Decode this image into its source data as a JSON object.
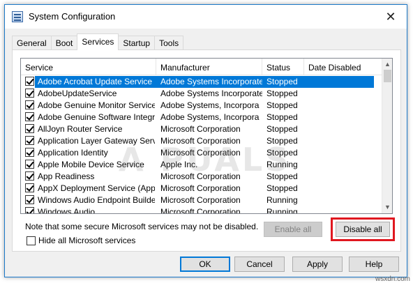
{
  "window": {
    "title": "System Configuration",
    "close_glyph": "✕"
  },
  "tabs": [
    "General",
    "Boot",
    "Services",
    "Startup",
    "Tools"
  ],
  "active_tab": "Services",
  "list": {
    "columns": [
      "Service",
      "Manufacturer",
      "Status",
      "Date Disabled"
    ],
    "rows": [
      {
        "service": "Adobe Acrobat Update Service",
        "manufacturer": "Adobe Systems Incorporated",
        "status": "Stopped",
        "date_disabled": "",
        "checked": true,
        "selected": true
      },
      {
        "service": "AdobeUpdateService",
        "manufacturer": "Adobe Systems Incorporated",
        "status": "Stopped",
        "date_disabled": "",
        "checked": true
      },
      {
        "service": "Adobe Genuine Monitor Service",
        "manufacturer": "Adobe Systems, Incorpora",
        "status": "Stopped",
        "date_disabled": "",
        "checked": true
      },
      {
        "service": "Adobe Genuine Software Integri...",
        "manufacturer": "Adobe Systems, Incorpora",
        "status": "Stopped",
        "date_disabled": "",
        "checked": true
      },
      {
        "service": "AllJoyn Router Service",
        "manufacturer": "Microsoft Corporation",
        "status": "Stopped",
        "date_disabled": "",
        "checked": true
      },
      {
        "service": "Application Layer Gateway Service",
        "manufacturer": "Microsoft Corporation",
        "status": "Stopped",
        "date_disabled": "",
        "checked": true
      },
      {
        "service": "Application Identity",
        "manufacturer": "Microsoft Corporation",
        "status": "Stopped",
        "date_disabled": "",
        "checked": true
      },
      {
        "service": "Apple Mobile Device Service",
        "manufacturer": "Apple Inc.",
        "status": "Running",
        "date_disabled": "",
        "checked": true
      },
      {
        "service": "App Readiness",
        "manufacturer": "Microsoft Corporation",
        "status": "Stopped",
        "date_disabled": "",
        "checked": true
      },
      {
        "service": "AppX Deployment Service (AppX...",
        "manufacturer": "Microsoft Corporation",
        "status": "Stopped",
        "date_disabled": "",
        "checked": true
      },
      {
        "service": "Windows Audio Endpoint Builder",
        "manufacturer": "Microsoft Corporation",
        "status": "Running",
        "date_disabled": "",
        "checked": true
      },
      {
        "service": "Windows Audio",
        "manufacturer": "Microsoft Corporation",
        "status": "Running",
        "date_disabled": "",
        "checked": true
      }
    ]
  },
  "scrollbar": {
    "up_glyph": "▲",
    "down_glyph": "▼"
  },
  "note": "Note that some secure Microsoft services may not be disabled.",
  "buttons": {
    "enable_all": "Enable all",
    "disable_all": "Disable all",
    "ok": "OK",
    "cancel": "Cancel",
    "apply": "Apply",
    "help": "Help"
  },
  "hide_ms_label": "Hide all Microsoft services",
  "hide_ms_checked": false,
  "watermark": "A  PUALS",
  "footer_mark": "wsxdn.com",
  "colors": {
    "selection": "#0078d7",
    "highlight": "#e0171f",
    "window_border": "#1c79c9"
  }
}
